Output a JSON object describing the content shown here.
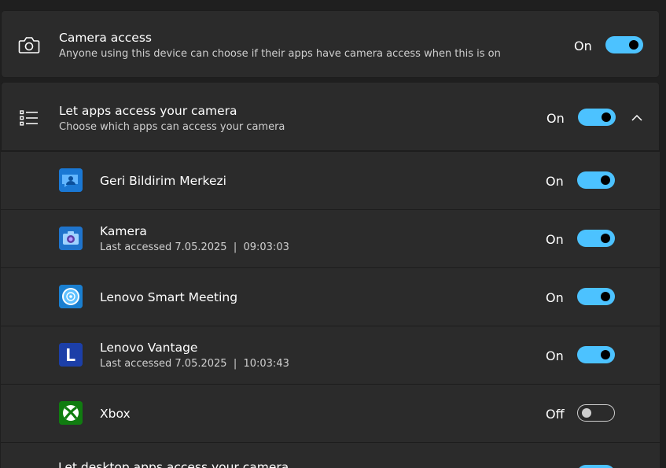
{
  "camera_access": {
    "title": "Camera access",
    "subtitle": "Anyone using this device can choose if their apps have camera access when this is on",
    "state": "On",
    "icon": "camera-icon"
  },
  "apps_access": {
    "title": "Let apps access your camera",
    "subtitle": "Choose which apps can access your camera",
    "state": "On",
    "icon": "list-icon",
    "expand_icon": "chevron-up-icon"
  },
  "apps": [
    {
      "name": "Geri Bildirim Merkezi",
      "last": "",
      "state": "On",
      "icon": "feedback-hub-icon",
      "color": "#0f6cbd"
    },
    {
      "name": "Kamera",
      "last": "Last accessed 7.05.2025  |  09:03:03",
      "state": "On",
      "icon": "camera-app-icon",
      "color": "#1f6fc5"
    },
    {
      "name": "Lenovo Smart Meeting",
      "last": "",
      "state": "On",
      "icon": "lenovo-smart-meeting-icon",
      "color": "#1a7fd0"
    },
    {
      "name": "Lenovo Vantage",
      "last": "Last accessed 7.05.2025  |  10:03:43",
      "state": "On",
      "icon": "lenovo-vantage-icon",
      "color": "#1c3fa8"
    },
    {
      "name": "Xbox",
      "last": "",
      "state": "Off",
      "icon": "xbox-icon",
      "color": "#107c10"
    }
  ],
  "desktop_apps": {
    "title": "Let desktop apps access your camera"
  },
  "colors": {
    "accent": "#4cc2ff",
    "background": "#1f1f1f",
    "card": "#2b2b2b"
  }
}
